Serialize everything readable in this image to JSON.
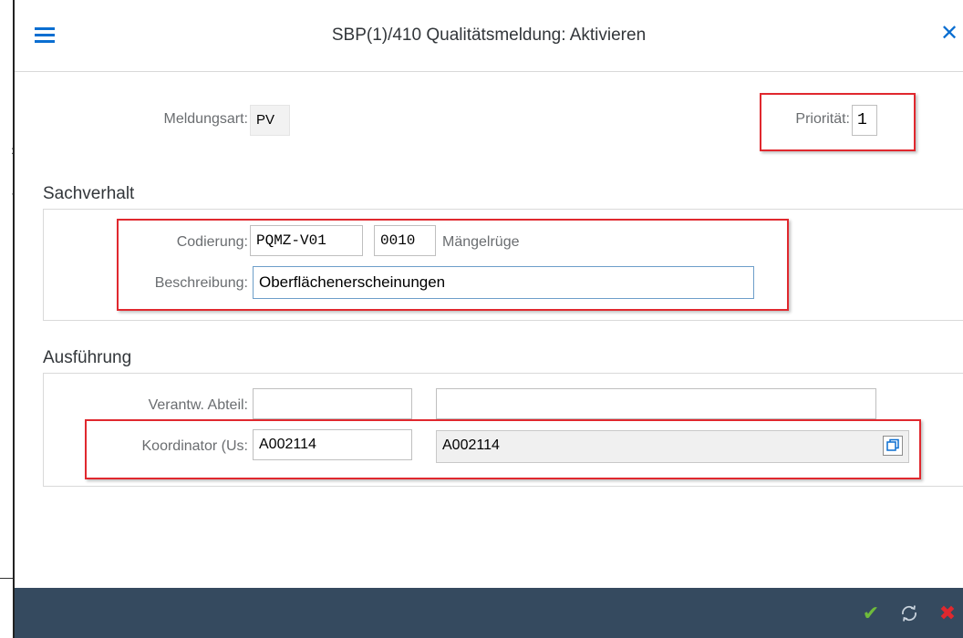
{
  "window": {
    "title": "SBP(1)/410 Qualitätsmeldung: Aktivieren"
  },
  "header": {
    "meldungsart_label": "Meldungsart:",
    "meldungsart_value": "PV",
    "prioritaet_label": "Priorität:",
    "prioritaet_value": "1"
  },
  "sachverhalt": {
    "title": "Sachverhalt",
    "codierung_label": "Codierung:",
    "codierung_value": "PQMZ-V01",
    "code_value": "0010",
    "code_text": "Mängelrüge",
    "beschreibung_label": "Beschreibung:",
    "beschreibung_value": "Oberflächenerscheinungen"
  },
  "ausfuehrung": {
    "title": "Ausführung",
    "abteilung_label": "Verantw. Abteil:",
    "abteilung_value": "",
    "abteilung_text": "",
    "koordinator_label": "Koordinator (Us:",
    "koordinator_value": "A002114",
    "koordinator_text": "A002114"
  },
  "footer": {
    "confirm_icon": "checkmark-icon",
    "refresh_icon": "refresh-icon",
    "cancel_icon": "cancel-icon"
  },
  "colors": {
    "accent": "#0a6ed1",
    "footer_bg": "#354a5f",
    "highlight_red": "#e0282e",
    "confirm_green": "#6fbb3b",
    "cancel_red": "#e0282e"
  }
}
